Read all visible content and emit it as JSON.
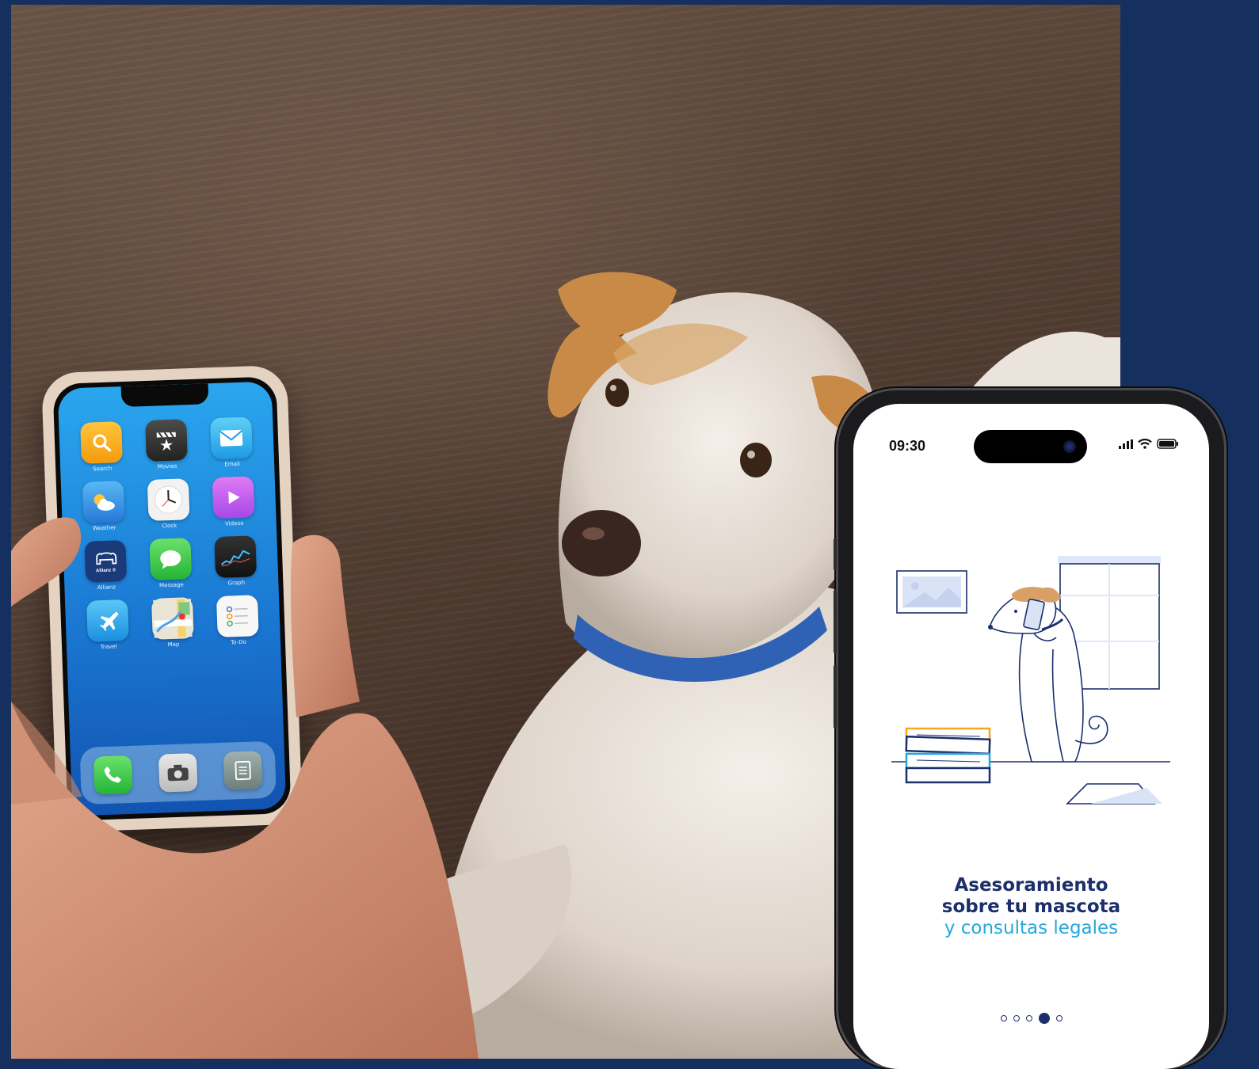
{
  "colors": {
    "background": "#15305e",
    "brand_navy": "#1b2f6b",
    "brand_cyan": "#26a7dc",
    "accent_orange": "#f6a81a"
  },
  "held_phone": {
    "apps": [
      {
        "label": "Search",
        "icon": "search-icon"
      },
      {
        "label": "Movies",
        "icon": "clapperboard-icon"
      },
      {
        "label": "Email",
        "icon": "envelope-icon"
      },
      {
        "label": "Weather",
        "icon": "weather-icon"
      },
      {
        "label": "Clock",
        "icon": "clock-icon"
      },
      {
        "label": "Videos",
        "icon": "play-icon"
      },
      {
        "label": "Allianz",
        "icon": "allianz-dog-icon",
        "badge": "Allianz ®"
      },
      {
        "label": "Message",
        "icon": "message-icon"
      },
      {
        "label": "Graph",
        "icon": "graph-icon"
      },
      {
        "label": "Travel",
        "icon": "airplane-icon"
      },
      {
        "label": "Map",
        "icon": "map-icon"
      },
      {
        "label": "To-Do",
        "icon": "todo-icon"
      }
    ],
    "dock": [
      {
        "icon": "phone-icon"
      },
      {
        "icon": "camera-icon"
      },
      {
        "icon": "notes-icon"
      }
    ]
  },
  "app_screen": {
    "status_time": "09:30",
    "status_icons": [
      "signal-icon",
      "wifi-icon",
      "battery-icon"
    ],
    "headline_line1": "Asesoramiento",
    "headline_line2": "sobre tu mascota",
    "headline_line3": "y consultas legales",
    "pager": {
      "total": 5,
      "active_index": 3
    }
  }
}
